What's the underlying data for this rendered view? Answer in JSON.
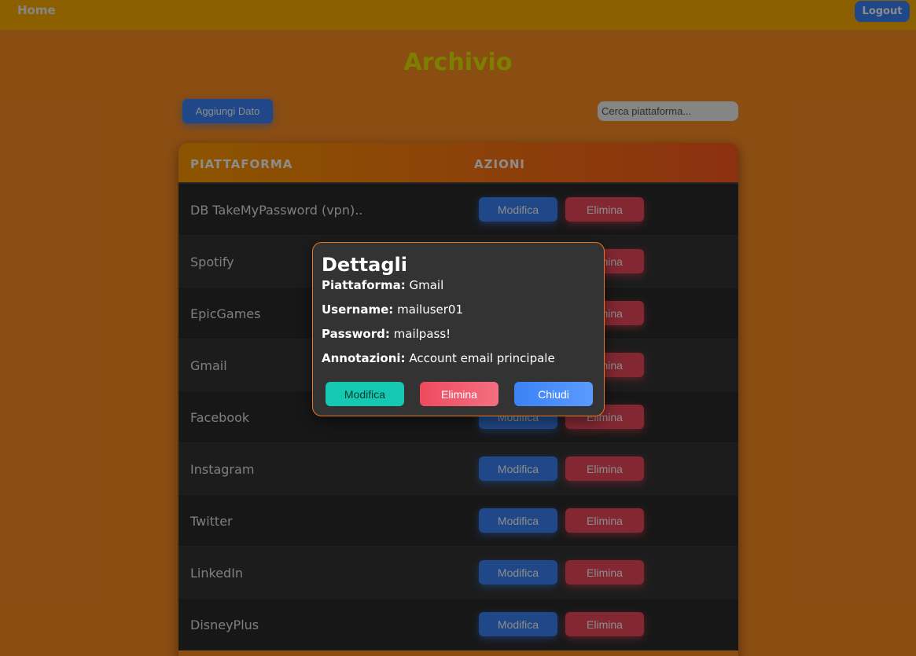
{
  "nav": {
    "home_label": "Home",
    "logout_label": "Logout"
  },
  "page": {
    "title": "Archivio",
    "add_label": "Aggiungi Dato",
    "search_placeholder": "Cerca piattaforma..."
  },
  "table": {
    "headers": [
      "PIATTAFORMA",
      "AZIONI"
    ],
    "edit_label": "Modifica",
    "delete_label": "Elimina",
    "rows": [
      "DB TakeMyPassword (vpn)..",
      "Spotify",
      "EpicGames",
      "Gmail",
      "Facebook",
      "Instagram",
      "Twitter",
      "LinkedIn",
      "DisneyPlus"
    ]
  },
  "modal": {
    "title": "Dettagli",
    "platform_label": "Piattaforma:",
    "platform_value": "Gmail",
    "username_label": "Username:",
    "username_value": "mailuser01",
    "password_label": "Password:",
    "password_value": "mailpass!",
    "notes_label": "Annotazioni:",
    "notes_value": "Account email principale",
    "edit_label": "Modifica",
    "delete_label": "Elimina",
    "close_label": "Chiudi"
  },
  "colors": {
    "background": "#fb8c22",
    "navbar": "#ffb000",
    "primary": "#3b82f6",
    "danger": "#ef4a5e",
    "teal": "#14c8b1",
    "title": "#e3e800"
  }
}
